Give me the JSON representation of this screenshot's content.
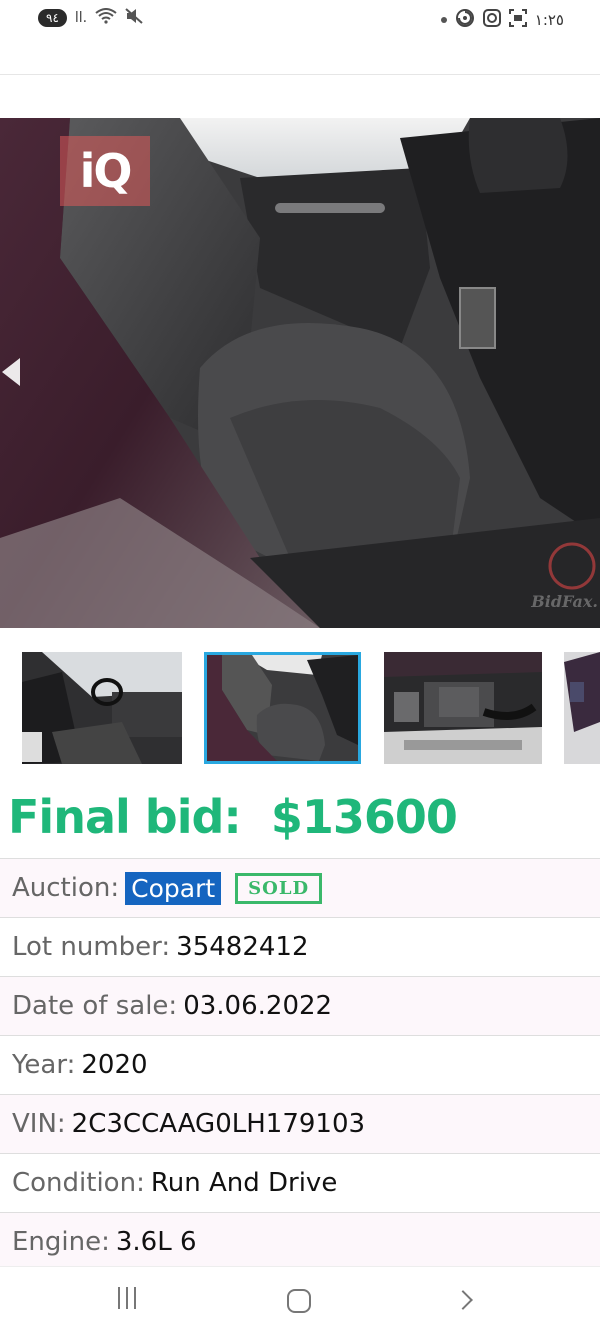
{
  "status_bar": {
    "badge": "٩٤",
    "signal": "ll.",
    "clock": "١:٢٥",
    "icons": [
      "wifi-icon",
      "mute-icon",
      "notification-dot-icon",
      "swirl-icon",
      "instagram-icon",
      "screenshot-icon"
    ]
  },
  "photo": {
    "watermark_logo": "iQ",
    "watermark_site": "BidFax."
  },
  "thumbnails": [
    {
      "subject": "front-interior",
      "selected": false
    },
    {
      "subject": "rear-seat",
      "selected": true
    },
    {
      "subject": "engine-bay",
      "selected": false
    },
    {
      "subject": "partial",
      "selected": false
    }
  ],
  "final_bid": {
    "label": "Final bid:",
    "amount": "$13600"
  },
  "details": {
    "auction_label": "Auction:",
    "auction_value": "Copart",
    "auction_stamp": "SOLD",
    "lot_label": "Lot number:",
    "lot_value": "35482412",
    "date_label": "Date of sale:",
    "date_value": "03.06.2022",
    "year_label": "Year:",
    "year_value": "2020",
    "vin_label": "VIN:",
    "vin_value": "2C3CCAAG0LH179103",
    "condition_label": "Condition:",
    "condition_value": "Run And Drive",
    "engine_label": "Engine:",
    "engine_value": "3.6L 6"
  },
  "colors": {
    "final_bid": "#1fb77a",
    "auction_badge": "#1565c0",
    "sold_stamp": "#3ab86a",
    "thumb_selected": "#29a8e0"
  }
}
